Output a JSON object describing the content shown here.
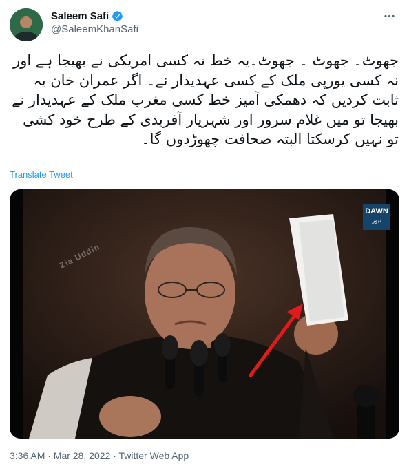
{
  "tweet": {
    "author": {
      "display_name": "Saleem Safi",
      "handle": "@SaleemKhanSafi",
      "verified": true
    },
    "more_icon": "more-horizontal-icon",
    "text": "جھوٹ۔ جھوٹ ۔ جھوٹ۔یہ خط نہ کسی امریکی نے بھیجا ہے اور نہ کسی یورپی ملک کے کسی عہدیدار نے۔ اگر عمران خان یہ ثابت کردیں کہ دھمکی آمیز خط کسی مغرب ملک کے عہدیدار نے بھیجا تو میں غلام سرور اور شہریار آفریدی کے طرح خود کشی تو نہیں کرسکتا البتہ صحافت چھوڑدوں گا۔",
    "translate_label": "Translate Tweet",
    "media": {
      "logo_text": "DAWN",
      "logo_subtext": "نیوز",
      "watermark": "Zia Uddin"
    },
    "timestamp": "3:36 AM · Mar 28, 2022 · Twitter Web App"
  },
  "colors": {
    "link": "#1d9bf0",
    "secondary_text": "#536471",
    "verified": "#1d9bf0"
  }
}
